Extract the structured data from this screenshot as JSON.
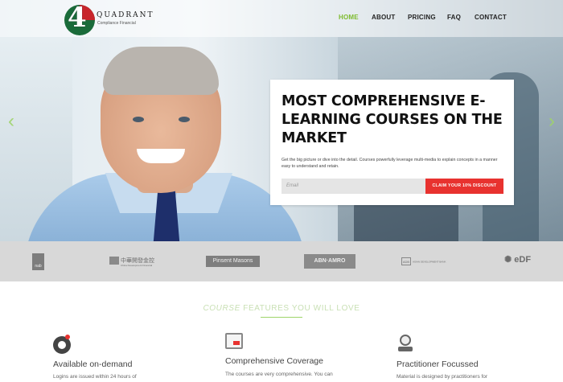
{
  "brand": {
    "logo_digit": "4",
    "logo_name": "QUADRANT",
    "logo_tagline": "Compliance Financial"
  },
  "nav": {
    "items": [
      {
        "label": "HOME",
        "active": true
      },
      {
        "label": "ABOUT",
        "active": false
      },
      {
        "label": "PRICING",
        "active": false
      },
      {
        "label": "FAQ",
        "active": false
      },
      {
        "label": "CONTACT",
        "active": false
      }
    ]
  },
  "hero": {
    "title": "MOST COMPREHENSIVE E-LEARNING COURSES ON THE MARKET",
    "description": "Get the big picture or dive into the detail. Courses powerfully leverage multi-media to explain concepts in a manner easy to understand and retain.",
    "email_placeholder": "Email",
    "cta_label": "CLAIM YOUR 10% DISCOUNT",
    "prev_arrow": "‹",
    "next_arrow": "›"
  },
  "partners": {
    "nab": "nab",
    "cdib": "中華開發金控",
    "cdib_sub": "China Development Financial",
    "pinsent": "Pinsent Masons",
    "abn": "ABN·AMRO",
    "adb_mark": "ADB",
    "adb": "ASIAN DEVELOPMENT BANK",
    "edf": "eDF"
  },
  "features": {
    "title_highlight": "COURSE",
    "title_rest": " FEATURES YOU WILL LOVE",
    "items": [
      {
        "title": "Available on-demand",
        "text": "Logins are issued within 24 hours of"
      },
      {
        "title": "Comprehensive Coverage",
        "text": "The courses are very comprehensive. You can"
      },
      {
        "title": "Practitioner Focussed",
        "text": "Material is designed by practitioners for"
      }
    ]
  },
  "colors": {
    "accent_green": "#7dbb2d",
    "cta_red": "#e8322f"
  }
}
